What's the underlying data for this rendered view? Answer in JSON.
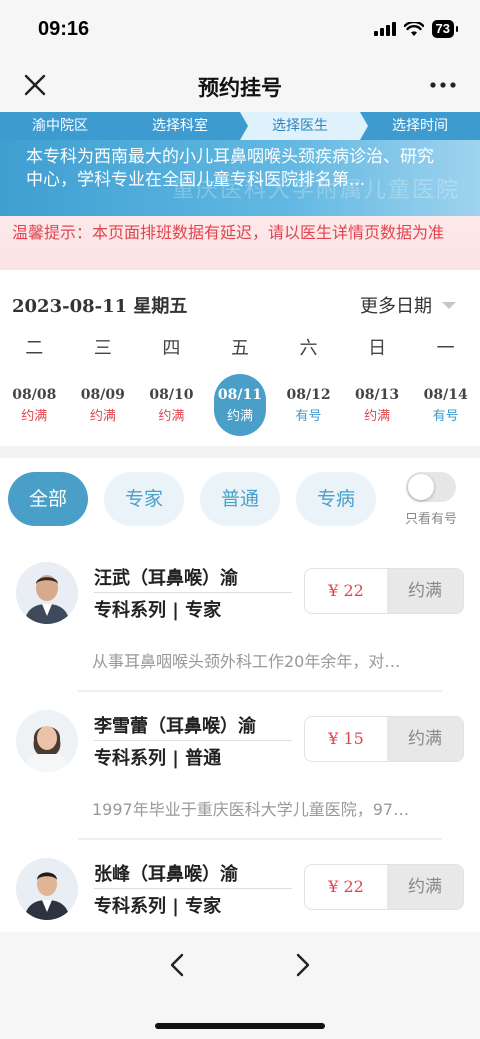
{
  "status": {
    "time": "09:16",
    "battery": "73"
  },
  "nav": {
    "title": "预约挂号"
  },
  "steps": [
    {
      "label": "渝中院区",
      "active": false
    },
    {
      "label": "选择科室",
      "active": false
    },
    {
      "label": "选择医生",
      "active": true
    },
    {
      "label": "选择时间",
      "active": false
    }
  ],
  "banner": {
    "text": "本专科为西南最大的小儿耳鼻咽喉头颈疾病诊治、研究中心，学科专业在全国儿童专科医院排名第...",
    "watermark": "重庆医科大学附属儿童医院"
  },
  "notice": "温馨提示：本页面排班数据有延迟，请以医生详情页数据为准",
  "date_header": "2023-08-11 星期五",
  "more_dates": "更多日期",
  "weekdays": [
    "二",
    "三",
    "四",
    "五",
    "六",
    "日",
    "一"
  ],
  "dates": [
    {
      "day": "08/08",
      "status": "约满",
      "available": false,
      "selected": false
    },
    {
      "day": "08/09",
      "status": "约满",
      "available": false,
      "selected": false
    },
    {
      "day": "08/10",
      "status": "约满",
      "available": false,
      "selected": false
    },
    {
      "day": "08/11",
      "status": "约满",
      "available": false,
      "selected": true
    },
    {
      "day": "08/12",
      "status": "有号",
      "available": true,
      "selected": false
    },
    {
      "day": "08/13",
      "status": "约满",
      "available": false,
      "selected": false
    },
    {
      "day": "08/14",
      "status": "有号",
      "available": true,
      "selected": false
    }
  ],
  "filters": [
    "全部",
    "专家",
    "普通",
    "专病"
  ],
  "toggle_label": "只看有号",
  "doctors": [
    {
      "name": "汪武（耳鼻喉）渝",
      "title": "专科系列 | 专家",
      "price": "¥ 22",
      "book": "约满",
      "desc": "从事耳鼻咽喉头颈外科工作20年余年，对…"
    },
    {
      "name": "李雪蕾（耳鼻喉）渝",
      "title": "专科系列 | 普通",
      "price": "¥ 15",
      "book": "约满",
      "desc": "1997年毕业于重庆医科大学儿童医院，97…"
    },
    {
      "name": "张峰（耳鼻喉）渝",
      "title": "专科系列 | 专家",
      "price": "¥ 22",
      "book": "约满",
      "desc": ""
    }
  ],
  "colors": {
    "accent": "#4a9fc9",
    "danger": "#e0454f"
  }
}
